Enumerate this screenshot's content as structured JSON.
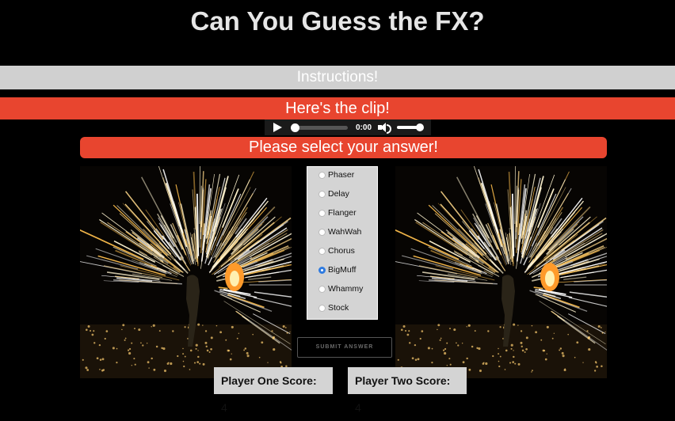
{
  "title": "Can You Guess the FX?",
  "instructions_label": "Instructions!",
  "clip_label": "Here's the clip!",
  "audio": {
    "time": "0:00",
    "progress": 0,
    "volume": 1
  },
  "select_label": "Please select your answer!",
  "options": [
    {
      "label": "Phaser",
      "selected": false
    },
    {
      "label": "Delay",
      "selected": false
    },
    {
      "label": "Flanger",
      "selected": false
    },
    {
      "label": "WahWah",
      "selected": false
    },
    {
      "label": "Chorus",
      "selected": false
    },
    {
      "label": "BigMuff",
      "selected": true
    },
    {
      "label": "Whammy",
      "selected": false
    },
    {
      "label": "Stock",
      "selected": false
    }
  ],
  "submit_label": "SUBMIT ANSWER",
  "scores": {
    "one_label": "Player One Score:",
    "one_value": "4",
    "two_label": "Player Two Score:",
    "two_value": "4"
  },
  "colors": {
    "accent": "#e8452f",
    "instructions_bar": "#d0d0d0",
    "radio_selected": "#2f7be0"
  },
  "icons": {
    "play": "play-icon",
    "volume": "volume-icon"
  }
}
